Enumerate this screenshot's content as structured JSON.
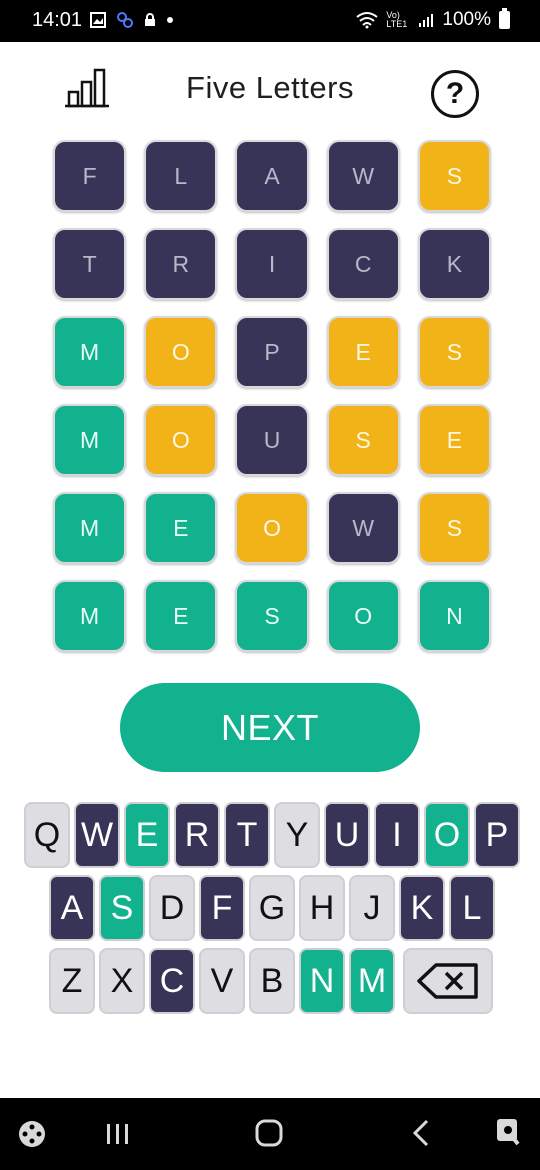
{
  "status_bar": {
    "time": "14:01",
    "battery": "100%",
    "network_label": "Vo) LTE1"
  },
  "header": {
    "title": "Five Letters",
    "stats_icon": "bar-chart-icon",
    "help_icon": "question-icon",
    "help_label": "?"
  },
  "board": {
    "rows": [
      [
        {
          "l": "F",
          "s": "absent"
        },
        {
          "l": "L",
          "s": "absent"
        },
        {
          "l": "A",
          "s": "absent"
        },
        {
          "l": "W",
          "s": "absent"
        },
        {
          "l": "S",
          "s": "present"
        }
      ],
      [
        {
          "l": "T",
          "s": "absent"
        },
        {
          "l": "R",
          "s": "absent"
        },
        {
          "l": "I",
          "s": "absent"
        },
        {
          "l": "C",
          "s": "absent"
        },
        {
          "l": "K",
          "s": "absent"
        }
      ],
      [
        {
          "l": "M",
          "s": "correct"
        },
        {
          "l": "O",
          "s": "present"
        },
        {
          "l": "P",
          "s": "absent"
        },
        {
          "l": "E",
          "s": "present"
        },
        {
          "l": "S",
          "s": "present"
        }
      ],
      [
        {
          "l": "M",
          "s": "correct"
        },
        {
          "l": "O",
          "s": "present"
        },
        {
          "l": "U",
          "s": "absent"
        },
        {
          "l": "S",
          "s": "present"
        },
        {
          "l": "E",
          "s": "present"
        }
      ],
      [
        {
          "l": "M",
          "s": "correct"
        },
        {
          "l": "E",
          "s": "correct"
        },
        {
          "l": "O",
          "s": "present"
        },
        {
          "l": "W",
          "s": "absent"
        },
        {
          "l": "S",
          "s": "present"
        }
      ],
      [
        {
          "l": "M",
          "s": "correct"
        },
        {
          "l": "E",
          "s": "correct"
        },
        {
          "l": "S",
          "s": "correct"
        },
        {
          "l": "O",
          "s": "correct"
        },
        {
          "l": "N",
          "s": "correct"
        }
      ]
    ]
  },
  "next_button": {
    "label": "NEXT"
  },
  "keyboard": {
    "rows": [
      [
        {
          "k": "Q",
          "s": "unused"
        },
        {
          "k": "W",
          "s": "absent"
        },
        {
          "k": "E",
          "s": "correct"
        },
        {
          "k": "R",
          "s": "absent"
        },
        {
          "k": "T",
          "s": "absent"
        },
        {
          "k": "Y",
          "s": "unused"
        },
        {
          "k": "U",
          "s": "absent"
        },
        {
          "k": "I",
          "s": "absent"
        },
        {
          "k": "O",
          "s": "correct"
        },
        {
          "k": "P",
          "s": "absent"
        }
      ],
      [
        {
          "k": "A",
          "s": "absent"
        },
        {
          "k": "S",
          "s": "correct"
        },
        {
          "k": "D",
          "s": "unused"
        },
        {
          "k": "F",
          "s": "absent"
        },
        {
          "k": "G",
          "s": "unused"
        },
        {
          "k": "H",
          "s": "unused"
        },
        {
          "k": "J",
          "s": "unused"
        },
        {
          "k": "K",
          "s": "absent"
        },
        {
          "k": "L",
          "s": "absent"
        }
      ],
      [
        {
          "k": "Z",
          "s": "unused"
        },
        {
          "k": "X",
          "s": "unused"
        },
        {
          "k": "C",
          "s": "absent"
        },
        {
          "k": "V",
          "s": "unused"
        },
        {
          "k": "B",
          "s": "unused"
        },
        {
          "k": "N",
          "s": "correct"
        },
        {
          "k": "M",
          "s": "correct"
        }
      ]
    ],
    "backspace_icon": "backspace-icon"
  },
  "colors": {
    "absent": "#373457",
    "present": "#f2b318",
    "correct": "#12b28f",
    "unused_key": "#dedee2"
  },
  "nav_bar": {
    "icons": [
      "game-launcher-icon",
      "recent-apps-icon",
      "home-icon",
      "back-icon",
      "assistant-icon"
    ]
  }
}
